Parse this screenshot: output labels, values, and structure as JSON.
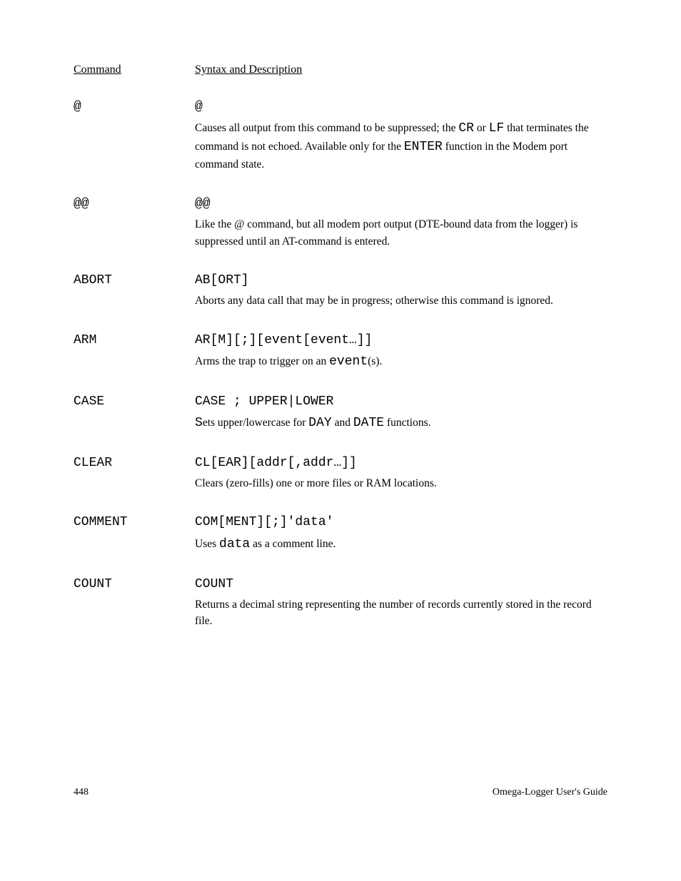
{
  "header": {
    "col1": "Command",
    "col2": "Syntax and Description"
  },
  "entries": [
    {
      "name": "@",
      "syntax": "@",
      "desc_parts": [
        {
          "t": "Causes all output from this command to be suppressed; the ",
          "cls": "serif"
        },
        {
          "t": "CR",
          "cls": "mono"
        },
        {
          "t": " or ",
          "cls": "serif"
        },
        {
          "t": "LF",
          "cls": "mono"
        },
        {
          "t": " that terminates the command is not echoed. Available only for the ",
          "cls": "serif"
        },
        {
          "t": "ENTER",
          "cls": "mono"
        },
        {
          "t": " function in the Modem port command state.",
          "cls": "serif"
        }
      ]
    },
    {
      "name": "@@",
      "syntax": "@@",
      "desc_parts": [
        {
          "t": "Like the @ command, but all modem port output (DTE-bound data from the logger) is suppressed until an AT-command is entered.",
          "cls": "serif"
        }
      ]
    },
    {
      "name": "ABORT",
      "syntax": "AB[ORT]",
      "desc_parts": [
        {
          "t": "Aborts any data call that may be in progress; otherwise this command is ignored.",
          "cls": "serif"
        }
      ]
    },
    {
      "name": "ARM",
      "syntax": "AR[M][;][event[event…]]",
      "desc_parts": [
        {
          "t": "Arms the trap to trigger on an ",
          "cls": "serif"
        },
        {
          "t": "event",
          "cls": "mono"
        },
        {
          "t": "(s).",
          "cls": "serif"
        }
      ]
    },
    {
      "name": "CASE",
      "syntax": "CASE ; UPPER|LOWER",
      "desc_parts": [
        {
          "t": "S",
          "cls": "mono"
        },
        {
          "t": "ets upper/lowercase for ",
          "cls": "serif"
        },
        {
          "t": "DAY",
          "cls": "mono"
        },
        {
          "t": " and ",
          "cls": "serif"
        },
        {
          "t": "DATE",
          "cls": "mono"
        },
        {
          "t": " functions.",
          "cls": "serif"
        }
      ]
    },
    {
      "name": "CLEAR",
      "syntax": "CL[EAR][addr[,addr…]]",
      "desc_parts": [
        {
          "t": "Clears (zero-fills) one or more files or RAM locations.",
          "cls": "serif"
        }
      ]
    },
    {
      "name": "COMMENT",
      "syntax": "COM[MENT][;]'data'",
      "desc_parts": [
        {
          "t": "Uses ",
          "cls": "serif"
        },
        {
          "t": "data",
          "cls": "mono"
        },
        {
          "t": " as a comment line.",
          "cls": "serif"
        }
      ]
    },
    {
      "name": "COUNT",
      "syntax": "COUNT",
      "desc_parts": [
        {
          "t": "Returns a decimal string representing the number of records currently stored in the record file.",
          "cls": "serif"
        }
      ]
    }
  ],
  "footer": {
    "left": "448",
    "right": "Omega-Logger User's Guide"
  }
}
